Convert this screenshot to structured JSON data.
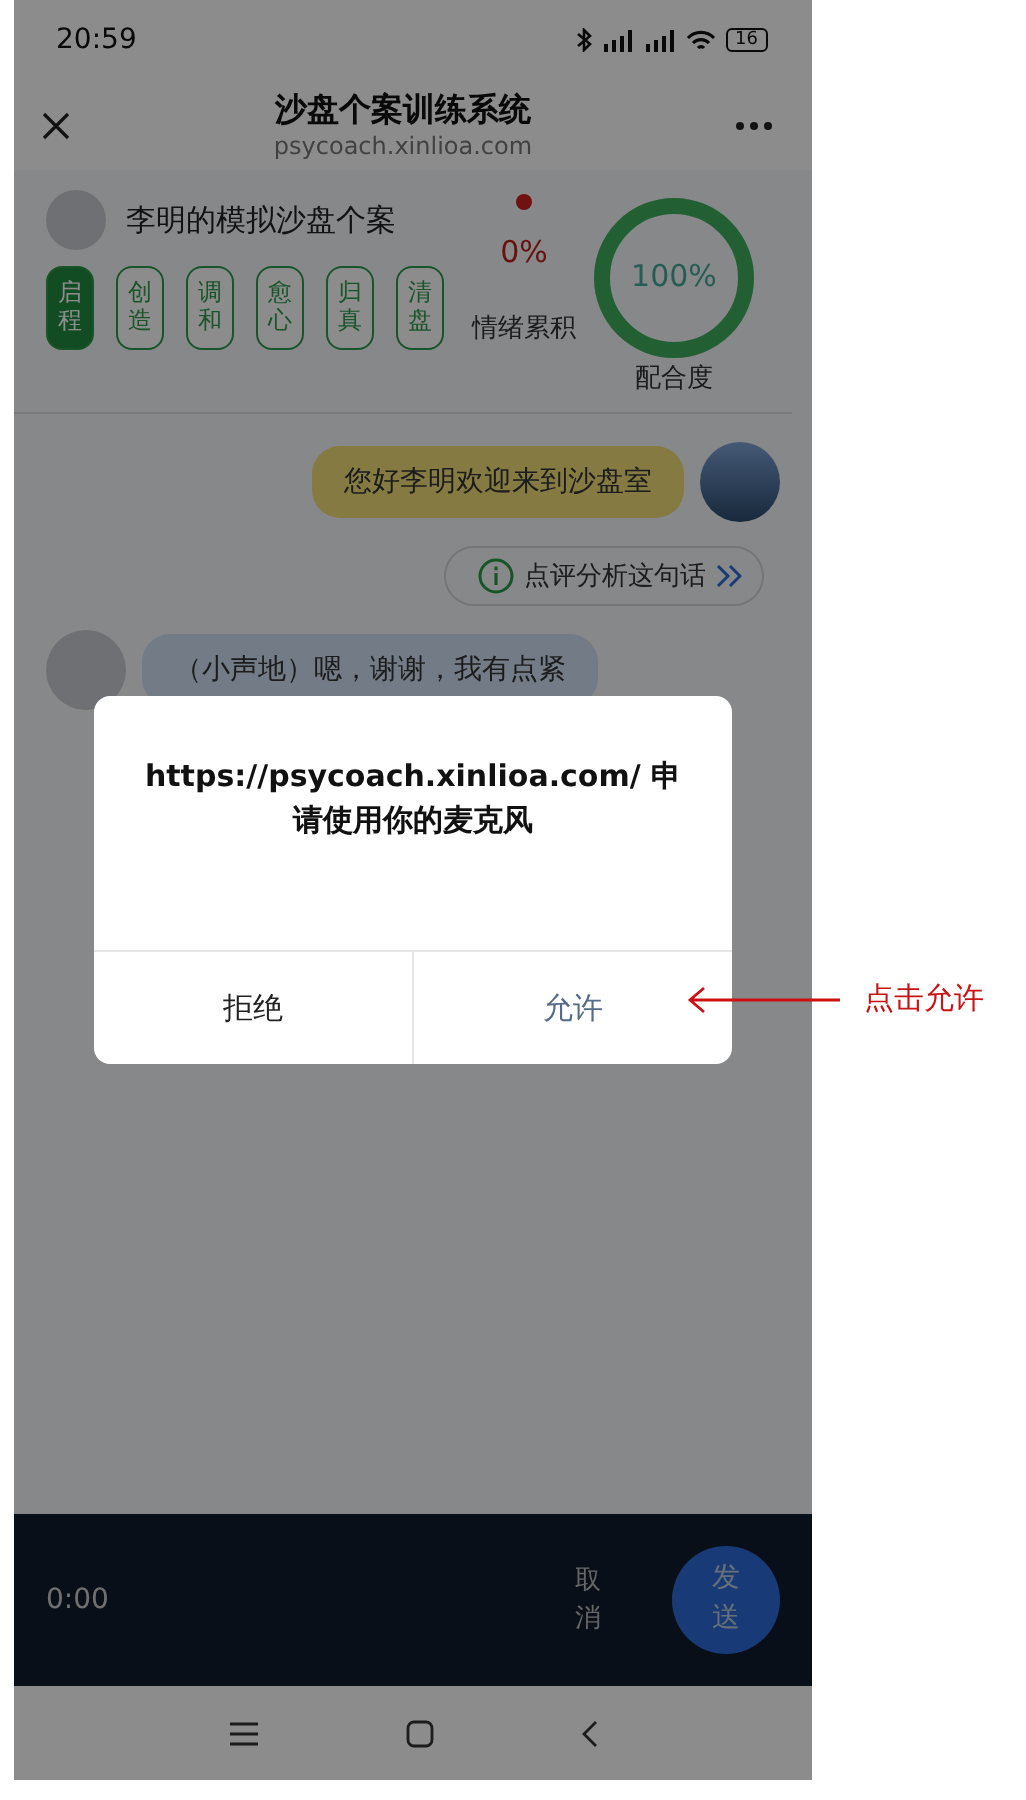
{
  "status_bar": {
    "time": "20:59",
    "battery": "16"
  },
  "header": {
    "title": "沙盘个案训练系统",
    "url": "psycoach.xinlioa.com"
  },
  "case": {
    "name": "李明的模拟沙盘个案",
    "stages": [
      {
        "label": "启程",
        "selected": true
      },
      {
        "label": "创造",
        "selected": false
      },
      {
        "label": "调和",
        "selected": false
      },
      {
        "label": "愈心",
        "selected": false
      },
      {
        "label": "归真",
        "selected": false
      },
      {
        "label": "清盘",
        "selected": false
      }
    ],
    "emotion": {
      "value": "0%",
      "label": "情绪累积"
    },
    "match": {
      "value": "100%",
      "label": "配合度",
      "level": 1
    }
  },
  "messages": [
    {
      "kind": "counselor",
      "text": "您好李明欢迎来到沙盘室"
    },
    {
      "kind": "review",
      "text": "点评分析这句话"
    },
    {
      "kind": "client",
      "text": "（小声地）嗯，谢谢，我有点紧"
    }
  ],
  "dialog": {
    "message": "https://psycoach.xinlioa.com/ 申请使用你的麦克风",
    "buttons": [
      {
        "label": "拒绝",
        "kind": "deny"
      },
      {
        "label": "允许",
        "kind": "allow"
      }
    ]
  },
  "recorder": {
    "time": "0:00",
    "cancel": "取消",
    "send": "发送"
  },
  "annotation": {
    "text": "点击允许"
  }
}
